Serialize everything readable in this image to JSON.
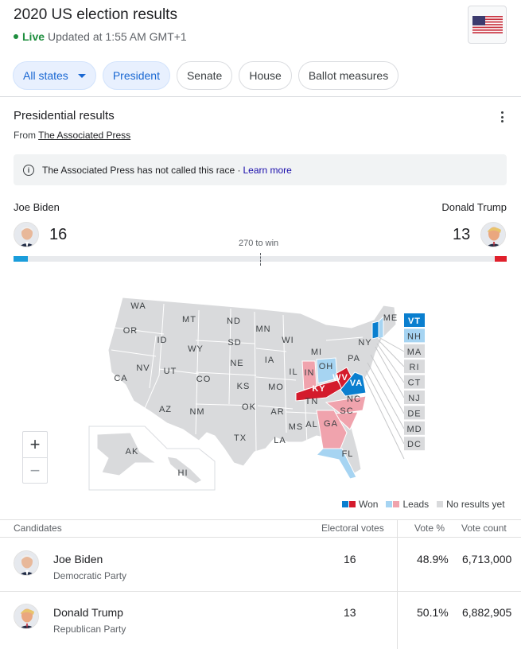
{
  "header": {
    "title": "2020 US election results",
    "live_label": "Live",
    "updated_text": "Updated at 1:55 AM GMT+1",
    "flag_icon": "us-flag-icon"
  },
  "filters": {
    "state_selector": "All states",
    "chips": [
      "President",
      "Senate",
      "House",
      "Ballot measures"
    ],
    "selected": "President"
  },
  "results": {
    "section_title": "Presidential results",
    "source_prefix": "From",
    "source_link": "The Associated Press",
    "notice_text": "The Associated Press has not called this race ·",
    "learn_more": "Learn more"
  },
  "race": {
    "biden": {
      "name": "Joe Biden",
      "electoral_votes": "16"
    },
    "trump": {
      "name": "Donald Trump",
      "electoral_votes": "13"
    },
    "threshold_label": "270 to win",
    "biden_progress": 0.0296,
    "trump_progress": 0.0241
  },
  "map": {
    "labels": {
      "WA": "WA",
      "OR": "OR",
      "CA": "CA",
      "ID": "ID",
      "NV": "NV",
      "MT": "MT",
      "WY": "WY",
      "UT": "UT",
      "AZ": "AZ",
      "CO": "CO",
      "NM": "NM",
      "ND": "ND",
      "SD": "SD",
      "NE": "NE",
      "KS": "KS",
      "OK": "OK",
      "TX": "TX",
      "MN": "MN",
      "IA": "IA",
      "MO": "MO",
      "AR": "AR",
      "LA": "LA",
      "WI": "WI",
      "IL": "IL",
      "MI": "MI",
      "IN": "IN",
      "OH": "OH",
      "KY": "KY",
      "TN": "TN",
      "MS": "MS",
      "AL": "AL",
      "GA": "GA",
      "FL": "FL",
      "SC": "SC",
      "NC": "NC",
      "VA": "VA",
      "WV": "WV",
      "PA": "PA",
      "NY": "NY",
      "ME": "ME",
      "AK": "AK",
      "HI": "HI"
    },
    "small_states": [
      "VT",
      "NH",
      "MA",
      "RI",
      "CT",
      "NJ",
      "DE",
      "MD",
      "DC"
    ],
    "colors": {
      "none": "#d9dadc",
      "biden_won": "#0a7fcf",
      "biden_leads": "#a6d4f2",
      "trump_won": "#d41b2c",
      "trump_leads": "#f0a3ad"
    },
    "zoom_in": "+",
    "zoom_out": "−"
  },
  "legend": {
    "won": "Won",
    "leads": "Leads",
    "none": "No results yet"
  },
  "table": {
    "headers": {
      "candidates": "Candidates",
      "electoral": "Electoral votes",
      "vote_pct": "Vote %",
      "vote_count": "Vote count"
    },
    "rows": [
      {
        "name": "Joe Biden",
        "party": "Democratic Party",
        "electoral": "16",
        "pct": "48.9%",
        "count": "6,713,000"
      },
      {
        "name": "Donald Trump",
        "party": "Republican Party",
        "electoral": "13",
        "pct": "50.1%",
        "count": "6,882,905"
      }
    ]
  }
}
